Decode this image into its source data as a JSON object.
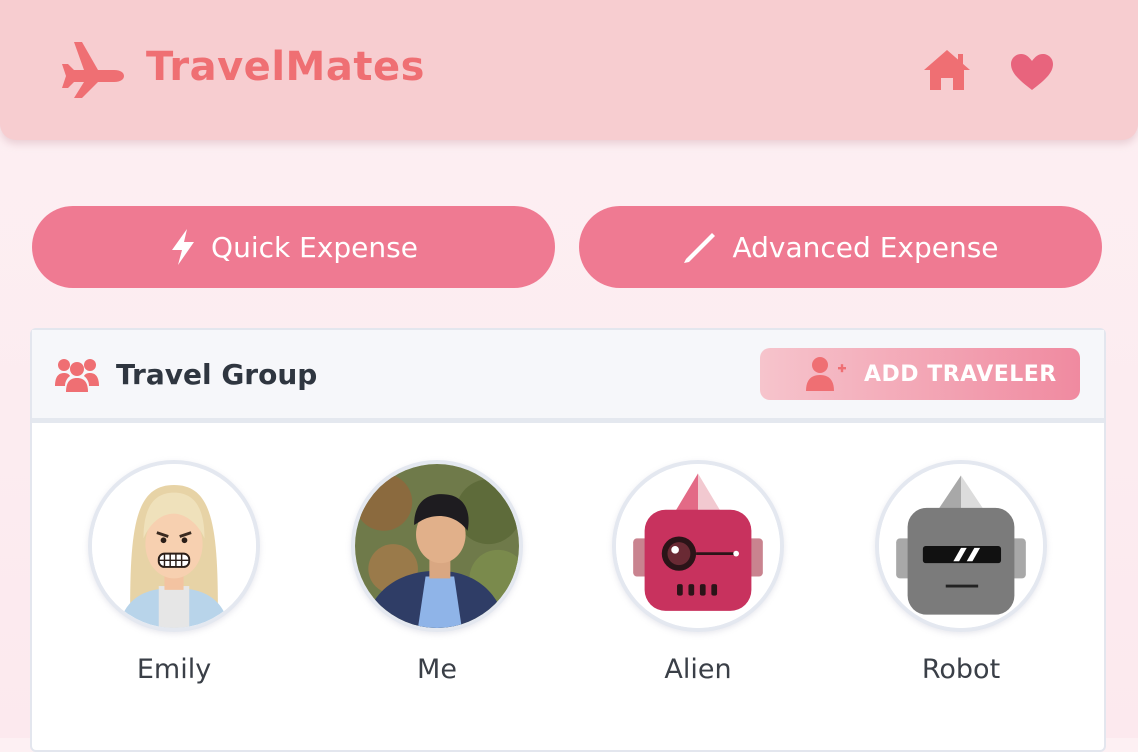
{
  "app": {
    "title": "TravelMates"
  },
  "header": {
    "icons": [
      "airplane-icon",
      "home-icon",
      "heart-icon"
    ]
  },
  "actions": {
    "quick_label": "Quick Expense",
    "advanced_label": "Advanced Expense"
  },
  "group": {
    "title": "Travel Group",
    "add_label": "ADD TRAVELER",
    "members": [
      {
        "name": "Emily",
        "avatar": "cartoon-woman-avatar"
      },
      {
        "name": "Me",
        "avatar": "photo-avatar"
      },
      {
        "name": "Alien",
        "avatar": "pink-robot-avatar"
      },
      {
        "name": "Robot",
        "avatar": "gray-robot-avatar"
      }
    ]
  },
  "colors": {
    "header_bg": "#f7cdd0",
    "accent": "#ef6f73",
    "button": "#ef7a92"
  }
}
